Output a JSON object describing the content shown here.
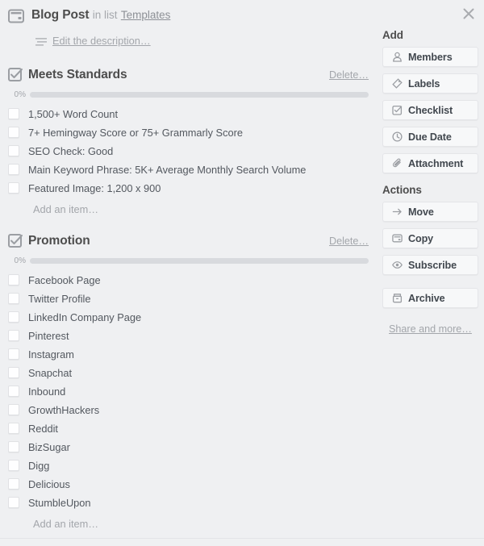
{
  "window": {
    "close_icon": "close-icon"
  },
  "header": {
    "card_icon": "card-icon",
    "title": "Blog Post",
    "in_list_label": "in list",
    "list_name": "Templates",
    "description_icon": "description-lines-icon",
    "description_label": "Edit the description…"
  },
  "checklists": [
    {
      "icon": "checklist-checked-icon",
      "title": "Meets Standards",
      "delete_label": "Delete…",
      "progress_pct": "0%",
      "progress_value": 0,
      "add_item_label": "Add an item…",
      "items": [
        {
          "label": "1,500+ Word Count",
          "checked": false
        },
        {
          "label": "7+ Hemingway Score or 75+ Grammarly Score",
          "checked": false
        },
        {
          "label": "SEO Check: Good",
          "checked": false
        },
        {
          "label": "Main Keyword Phrase: 5K+ Average Monthly Search Volume",
          "checked": false
        },
        {
          "label": "Featured Image: 1,200 x 900",
          "checked": false
        }
      ]
    },
    {
      "icon": "checklist-checked-icon",
      "title": "Promotion",
      "delete_label": "Delete…",
      "progress_pct": "0%",
      "progress_value": 0,
      "add_item_label": "Add an item…",
      "items": [
        {
          "label": "Facebook Page",
          "checked": false
        },
        {
          "label": "Twitter Profile",
          "checked": false
        },
        {
          "label": "LinkedIn Company Page",
          "checked": false
        },
        {
          "label": "Pinterest",
          "checked": false
        },
        {
          "label": "Instagram",
          "checked": false
        },
        {
          "label": "Snapchat",
          "checked": false
        },
        {
          "label": "Inbound",
          "checked": false
        },
        {
          "label": "GrowthHackers",
          "checked": false
        },
        {
          "label": "Reddit",
          "checked": false
        },
        {
          "label": "BizSugar",
          "checked": false
        },
        {
          "label": "Digg",
          "checked": false
        },
        {
          "label": "Delicious",
          "checked": false
        },
        {
          "label": "StumbleUpon",
          "checked": false
        }
      ]
    }
  ],
  "sidebar": {
    "add_heading": "Add",
    "add_buttons": [
      {
        "label": "Members",
        "icon": "person-icon"
      },
      {
        "label": "Labels",
        "icon": "tag-icon"
      },
      {
        "label": "Checklist",
        "icon": "checklist-icon"
      },
      {
        "label": "Due Date",
        "icon": "clock-icon"
      },
      {
        "label": "Attachment",
        "icon": "paperclip-icon"
      }
    ],
    "actions_heading": "Actions",
    "action_buttons": [
      {
        "label": "Move",
        "icon": "arrow-right-icon"
      },
      {
        "label": "Copy",
        "icon": "card-copy-icon"
      },
      {
        "label": "Subscribe",
        "icon": "eye-icon"
      }
    ],
    "archive_button": {
      "label": "Archive",
      "icon": "archive-box-icon"
    },
    "share_link": "Share and more…"
  },
  "colors": {
    "background": "#eff0f2",
    "text_dark": "#4d4d4d",
    "text_body": "#53585f",
    "text_muted": "#a3a6ab",
    "progress_track": "#d8dade",
    "button_bg": "#f7f8f9",
    "button_border": "#e4e5e8"
  }
}
